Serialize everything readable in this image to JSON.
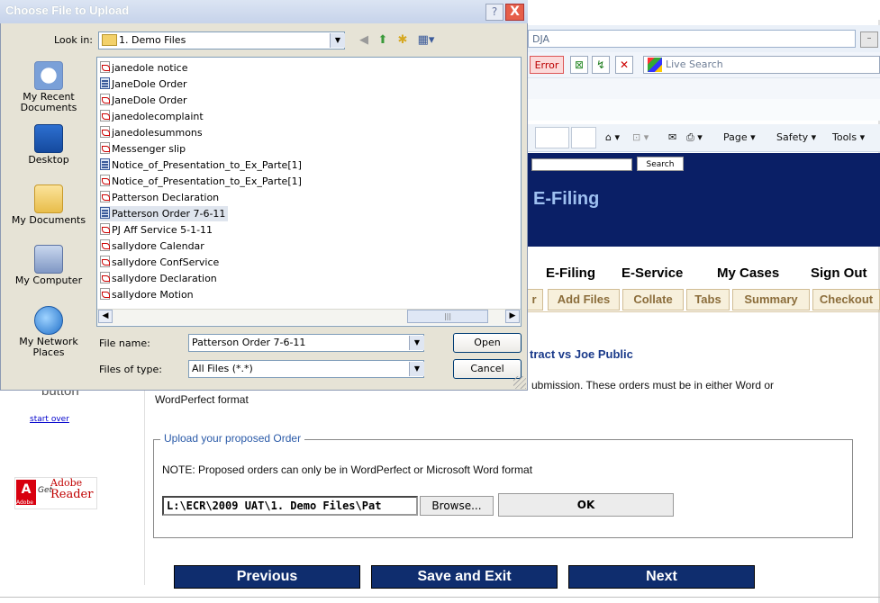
{
  "browser": {
    "title_fragment": "DJA",
    "error_label": "Error",
    "live_search_placeholder": "Live Search",
    "minimize": "–",
    "command_bar": {
      "page": "Page ▾",
      "safety": "Safety ▾",
      "tools": "Tools ▾"
    }
  },
  "site": {
    "search_button": "Search",
    "banner_title": "E-Filing",
    "nav": [
      "E-Filing",
      "E-Service",
      "My Cases",
      "Sign Out"
    ],
    "tabs": [
      "r",
      "Add Files",
      "Collate",
      "Tabs",
      "Summary",
      "Checkout"
    ],
    "case_title": "tract vs Joe Public",
    "instructions_line1": "ubmission. These orders must be in either Word or",
    "instructions_line2": "WordPerfect format",
    "left_button_text": "button",
    "start_over": "start over",
    "adobe": {
      "get": "Get",
      "adobe": "Adobe",
      "reader": "Reader",
      "tm": "Adobe"
    },
    "upload": {
      "legend": "Upload your proposed Order",
      "note": "NOTE: Proposed orders can only be in WordPerfect or Microsoft Word format",
      "path_value": "L:\\ECR\\2009 UAT\\1. Demo Files\\Pat",
      "browse": "Browse...",
      "ok": "OK"
    },
    "buttons": {
      "previous": "Previous",
      "save_exit": "Save and Exit",
      "next": "Next"
    }
  },
  "dialog": {
    "title": "Choose File to Upload",
    "help": "?",
    "close": "X",
    "look_in_label": "Look in:",
    "look_in_value": "1. Demo Files",
    "places": [
      "My Recent Documents",
      "Desktop",
      "My Documents",
      "My Computer",
      "My Network Places"
    ],
    "files": [
      {
        "name": "janedole notice",
        "type": "pdf"
      },
      {
        "name": "JaneDole Order",
        "type": "wp"
      },
      {
        "name": "JaneDole Order",
        "type": "pdf"
      },
      {
        "name": "janedolecomplaint",
        "type": "pdf"
      },
      {
        "name": "janedolesummons",
        "type": "pdf"
      },
      {
        "name": "Messenger slip",
        "type": "pdf"
      },
      {
        "name": "Notice_of_Presentation_to_Ex_Parte[1]",
        "type": "wp"
      },
      {
        "name": "Notice_of_Presentation_to_Ex_Parte[1]",
        "type": "pdf"
      },
      {
        "name": "Patterson Declaration",
        "type": "pdf"
      },
      {
        "name": "Patterson Order 7-6-11",
        "type": "wp",
        "selected": true
      },
      {
        "name": "PJ Aff Service 5-1-11",
        "type": "pdf"
      },
      {
        "name": "sallydore Calendar",
        "type": "pdf"
      },
      {
        "name": "sallydore ConfService",
        "type": "pdf"
      },
      {
        "name": "sallydore Declaration",
        "type": "pdf"
      },
      {
        "name": "sallydore Motion",
        "type": "pdf"
      }
    ],
    "file_name_label": "File name:",
    "file_name_value": "Patterson Order 7-6-11",
    "files_of_type_label": "Files of type:",
    "files_of_type_value": "All Files (*.*)",
    "open": "Open",
    "cancel": "Cancel"
  }
}
